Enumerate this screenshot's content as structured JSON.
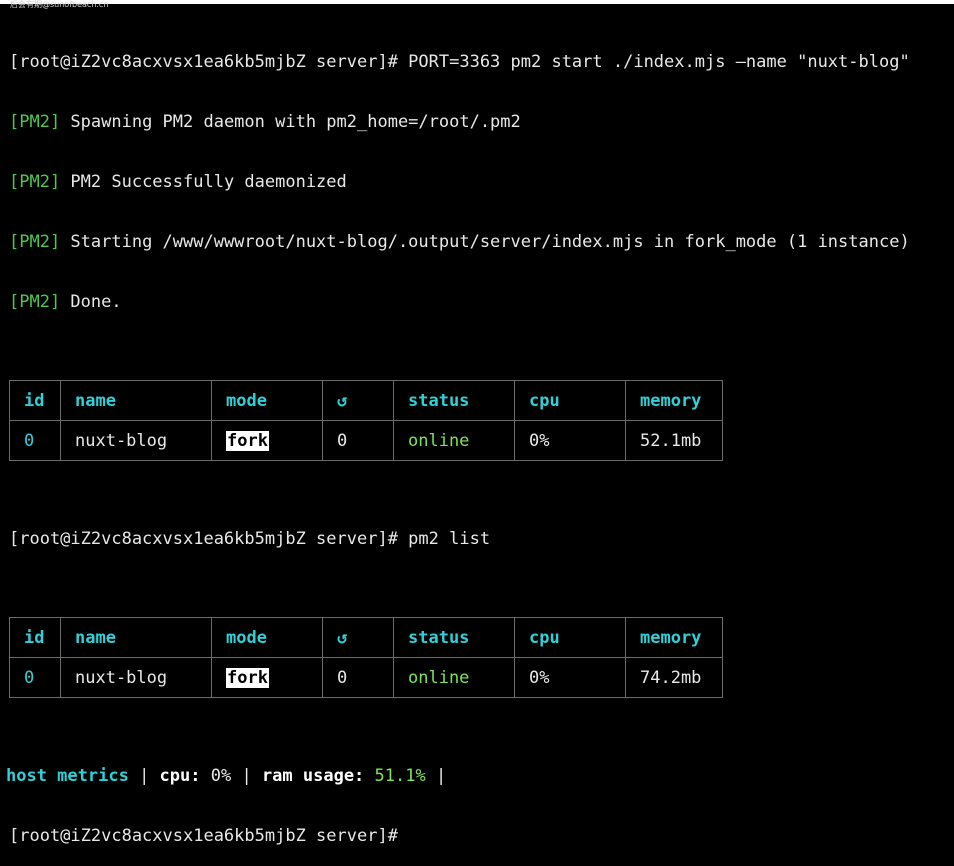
{
  "watermark": "后会有期@sunofbeach.cn",
  "terminal": {
    "cmd1_prompt": "[root@iZ2vc8acxvsx1ea6kb5mjbZ server]# ",
    "cmd1_text": "PORT=3363 pm2 start ./index.mjs —name \"nuxt-blog\"",
    "log": [
      {
        "tag": "[PM2]",
        "text": " Spawning PM2 daemon with pm2_home=/root/.pm2"
      },
      {
        "tag": "[PM2]",
        "text": " PM2 Successfully daemonized"
      },
      {
        "tag": "[PM2]",
        "text": " Starting /www/wwwroot/nuxt-blog/.output/server/index.mjs in fork_mode (1 instance)"
      },
      {
        "tag": "[PM2]",
        "text": " Done."
      }
    ],
    "table_headers": {
      "id": "id",
      "name": "name",
      "mode": "mode",
      "restart": "↺",
      "status": "status",
      "cpu": "cpu",
      "memory": "memory"
    },
    "table1": {
      "id": "0",
      "name": "nuxt-blog",
      "mode": "fork",
      "restart": "0",
      "status": "online",
      "cpu": "0%",
      "memory": "52.1mb"
    },
    "cmd2_prompt": "[root@iZ2vc8acxvsx1ea6kb5mjbZ server]# ",
    "cmd2_text": "pm2 list",
    "table2": {
      "id": "0",
      "name": "nuxt-blog",
      "mode": "fork",
      "restart": "0",
      "status": "online",
      "cpu": "0%",
      "memory": "74.2mb"
    },
    "metrics": {
      "label": "host metrics",
      "sep1": " | ",
      "cpu_key": "cpu:",
      "cpu_value": " 0%",
      "sep2": " | ",
      "ram_key": "ram usage:",
      "ram_value": " 51.1%",
      "sep3": " |"
    },
    "final_prompt": "[root@iZ2vc8acxvsx1ea6kb5mjbZ server]#"
  },
  "colors": {
    "background": "#000000",
    "pm2_tag": "#4ec94e",
    "header_cyan": "#2fd0d8",
    "status_green": "#7ee35a"
  }
}
